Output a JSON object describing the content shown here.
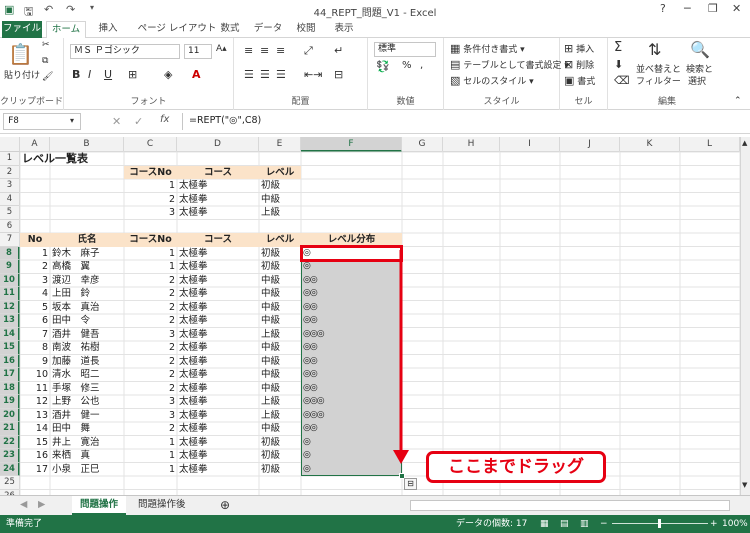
{
  "window": {
    "title": "44_REPT_問題_V1 - Excel",
    "help": "?",
    "min": "─",
    "restore": "❐",
    "close": "✕"
  },
  "tabs": [
    {
      "label": "ファイル"
    },
    {
      "label": "ホーム"
    },
    {
      "label": "挿入"
    },
    {
      "label": "ページ レイアウト"
    },
    {
      "label": "数式"
    },
    {
      "label": "データ"
    },
    {
      "label": "校閲"
    },
    {
      "label": "表示"
    }
  ],
  "ribbon": {
    "clipboard": {
      "label": "クリップボード",
      "paste": "貼り付け"
    },
    "font": {
      "label": "フォント",
      "name": "ＭＳ Ｐゴシック",
      "size": "11"
    },
    "alignment": {
      "label": "配置"
    },
    "number": {
      "label": "数値",
      "format": "標準",
      "percent": "%"
    },
    "styles": {
      "label": "スタイル",
      "conditional": "条件付き書式",
      "table": "テーブルとして書式設定",
      "cell": "セルのスタイル"
    },
    "cells": {
      "label": "セル",
      "insert": "挿入",
      "delete": "削除",
      "format": "書式"
    },
    "editing": {
      "label": "編集",
      "sort": "並べ替えと",
      "sort2": "フィルター",
      "find": "検索と",
      "find2": "選択"
    }
  },
  "formula_bar": {
    "name_box": "F8",
    "fx": "fx",
    "formula": "=REPT(\"◎\",C8)"
  },
  "columns": [
    "A",
    "B",
    "C",
    "D",
    "E",
    "F",
    "G",
    "H",
    "I",
    "J",
    "K",
    "L"
  ],
  "rows": [
    "1",
    "2",
    "3",
    "4",
    "5",
    "6",
    "7",
    "8",
    "9",
    "10",
    "11",
    "12",
    "13",
    "14",
    "15",
    "16",
    "17",
    "18",
    "19",
    "20",
    "21",
    "22",
    "23",
    "24",
    "25",
    "26"
  ],
  "sheet": {
    "title": "レベル一覧表",
    "course_table": {
      "headers": [
        "コースNo",
        "コース",
        "レベル"
      ],
      "rows": [
        [
          "1",
          "太極拳",
          "初級"
        ],
        [
          "2",
          "太極拳",
          "中級"
        ],
        [
          "3",
          "太極拳",
          "上級"
        ]
      ]
    },
    "main_table": {
      "headers": [
        "No",
        "氏名",
        "コースNo",
        "コース",
        "レベル",
        "レベル分布"
      ],
      "rows": [
        [
          "1",
          "鈴木　麻子",
          "1",
          "太極拳",
          "初級",
          "◎"
        ],
        [
          "2",
          "高橋　翼",
          "1",
          "太極拳",
          "初級",
          "◎"
        ],
        [
          "3",
          "渡辺　幸彦",
          "2",
          "太極拳",
          "中級",
          "◎◎"
        ],
        [
          "4",
          "上田　鈴",
          "2",
          "太極拳",
          "中級",
          "◎◎"
        ],
        [
          "5",
          "坂本　真治",
          "2",
          "太極拳",
          "中級",
          "◎◎"
        ],
        [
          "6",
          "田中　令",
          "2",
          "太極拳",
          "中級",
          "◎◎"
        ],
        [
          "7",
          "酒井　健吾",
          "3",
          "太極拳",
          "上級",
          "◎◎◎"
        ],
        [
          "8",
          "南波　祐樹",
          "2",
          "太極拳",
          "中級",
          "◎◎"
        ],
        [
          "9",
          "加藤　道長",
          "2",
          "太極拳",
          "中級",
          "◎◎"
        ],
        [
          "10",
          "清水　昭二",
          "2",
          "太極拳",
          "中級",
          "◎◎"
        ],
        [
          "11",
          "手塚　修三",
          "2",
          "太極拳",
          "中級",
          "◎◎"
        ],
        [
          "12",
          "上野　公也",
          "3",
          "太極拳",
          "上級",
          "◎◎◎"
        ],
        [
          "13",
          "酒井　健一",
          "3",
          "太極拳",
          "上級",
          "◎◎◎"
        ],
        [
          "14",
          "田中　舞",
          "2",
          "太極拳",
          "中級",
          "◎◎"
        ],
        [
          "15",
          "井上　寛治",
          "1",
          "太極拳",
          "初級",
          "◎"
        ],
        [
          "16",
          "来栖　真",
          "1",
          "太極拳",
          "初級",
          "◎"
        ],
        [
          "17",
          "小泉　正巳",
          "1",
          "太極拳",
          "初級",
          "◎"
        ]
      ]
    }
  },
  "sheet_tabs": [
    {
      "label": "問題操作"
    },
    {
      "label": "問題操作後"
    }
  ],
  "status": {
    "ready": "準備完了",
    "count": "データの個数: 17",
    "zoom": "100%"
  },
  "callout": {
    "text": "ここまでドラッグ"
  },
  "colors": {
    "accent": "#217346",
    "header_fill": "#fbe3c9",
    "highlight": "#e60012"
  }
}
